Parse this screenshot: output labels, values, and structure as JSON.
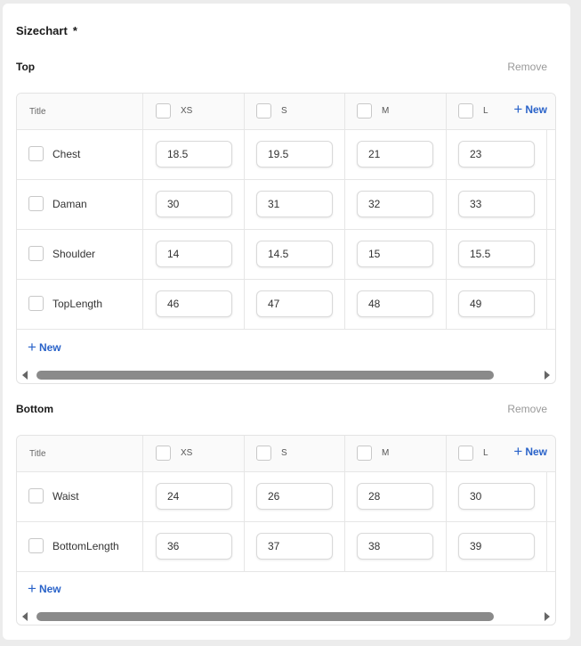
{
  "title": "Sizechart",
  "required_mark": "*",
  "sections": [
    {
      "name": "Top",
      "remove_label": "Remove",
      "header": {
        "title": "Title",
        "sizes": [
          "XS",
          "S",
          "M",
          "L"
        ],
        "new_label": "New"
      },
      "rows": [
        {
          "label": "Chest",
          "values": [
            "18.5",
            "19.5",
            "21",
            "23"
          ]
        },
        {
          "label": "Daman",
          "values": [
            "30",
            "31",
            "32",
            "33"
          ]
        },
        {
          "label": "Shoulder",
          "values": [
            "14",
            "14.5",
            "15",
            "15.5"
          ]
        },
        {
          "label": "TopLength",
          "values": [
            "46",
            "47",
            "48",
            "49"
          ]
        }
      ],
      "new_row_label": "New"
    },
    {
      "name": "Bottom",
      "remove_label": "Remove",
      "header": {
        "title": "Title",
        "sizes": [
          "XS",
          "S",
          "M",
          "L"
        ],
        "new_label": "New"
      },
      "rows": [
        {
          "label": "Waist",
          "values": [
            "24",
            "26",
            "28",
            "30"
          ]
        },
        {
          "label": "BottomLength",
          "values": [
            "36",
            "37",
            "38",
            "39"
          ]
        }
      ],
      "new_row_label": "New"
    }
  ],
  "icons": {
    "add": "plus-icon",
    "scroll_left": "arrow-left-icon",
    "scroll_right": "arrow-right-icon"
  },
  "colors": {
    "link": "#2a63c9",
    "muted": "#999999",
    "scroll_thumb": "#8a8a8a"
  }
}
